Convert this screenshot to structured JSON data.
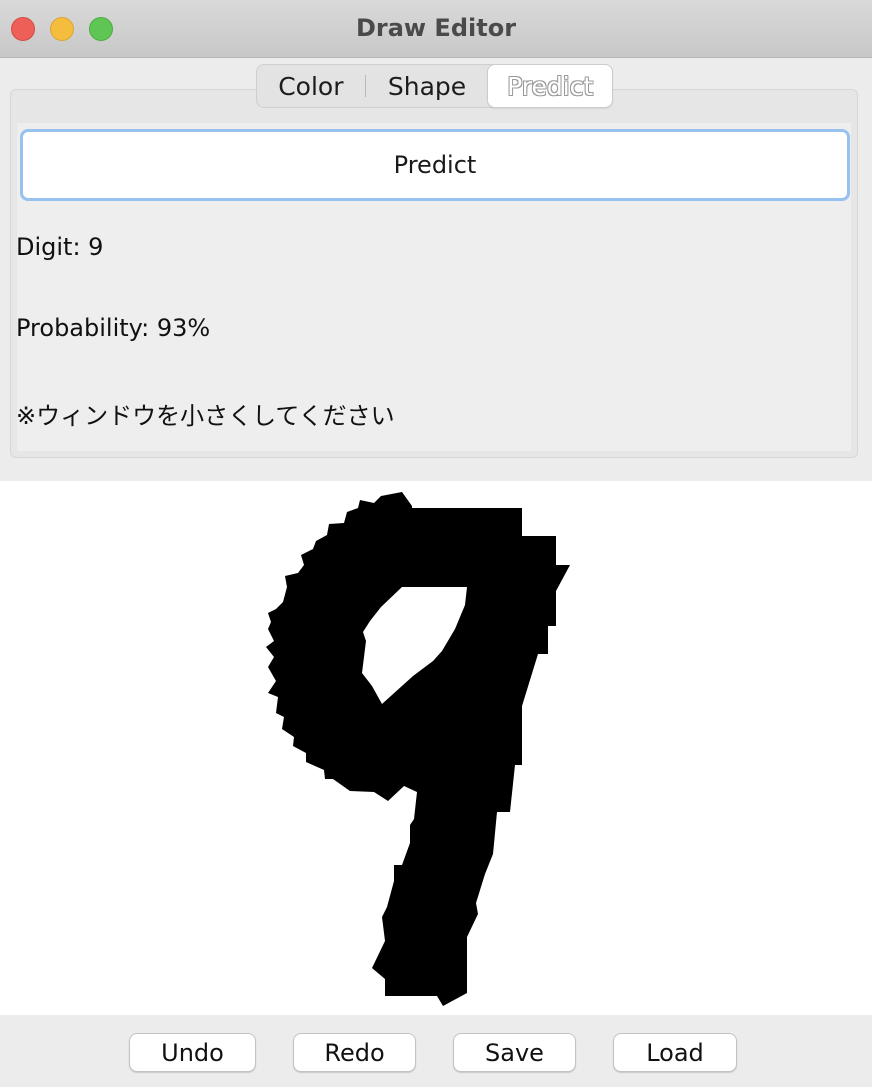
{
  "window": {
    "title": "Draw Editor"
  },
  "tabs": [
    {
      "label": "Color"
    },
    {
      "label": "Shape"
    },
    {
      "label": "Predict",
      "selected": true
    }
  ],
  "predict_panel": {
    "button_label": "Predict",
    "digit_text": "Digit: 9",
    "probability_text": "Probability: 93%",
    "note_text": "※ウィンドウを小さくしてください"
  },
  "canvas": {
    "drawing": "hand-drawn digit 9",
    "stroke_color": "#000000",
    "background_color": "#ffffff"
  },
  "toolbar": {
    "undo_label": "Undo",
    "redo_label": "Redo",
    "save_label": "Save",
    "load_label": "Load"
  },
  "colors": {
    "close": "#ee5f57",
    "minimize": "#f5bd3e",
    "maximize": "#5fc653",
    "focus_ring": "#97c1ee"
  }
}
